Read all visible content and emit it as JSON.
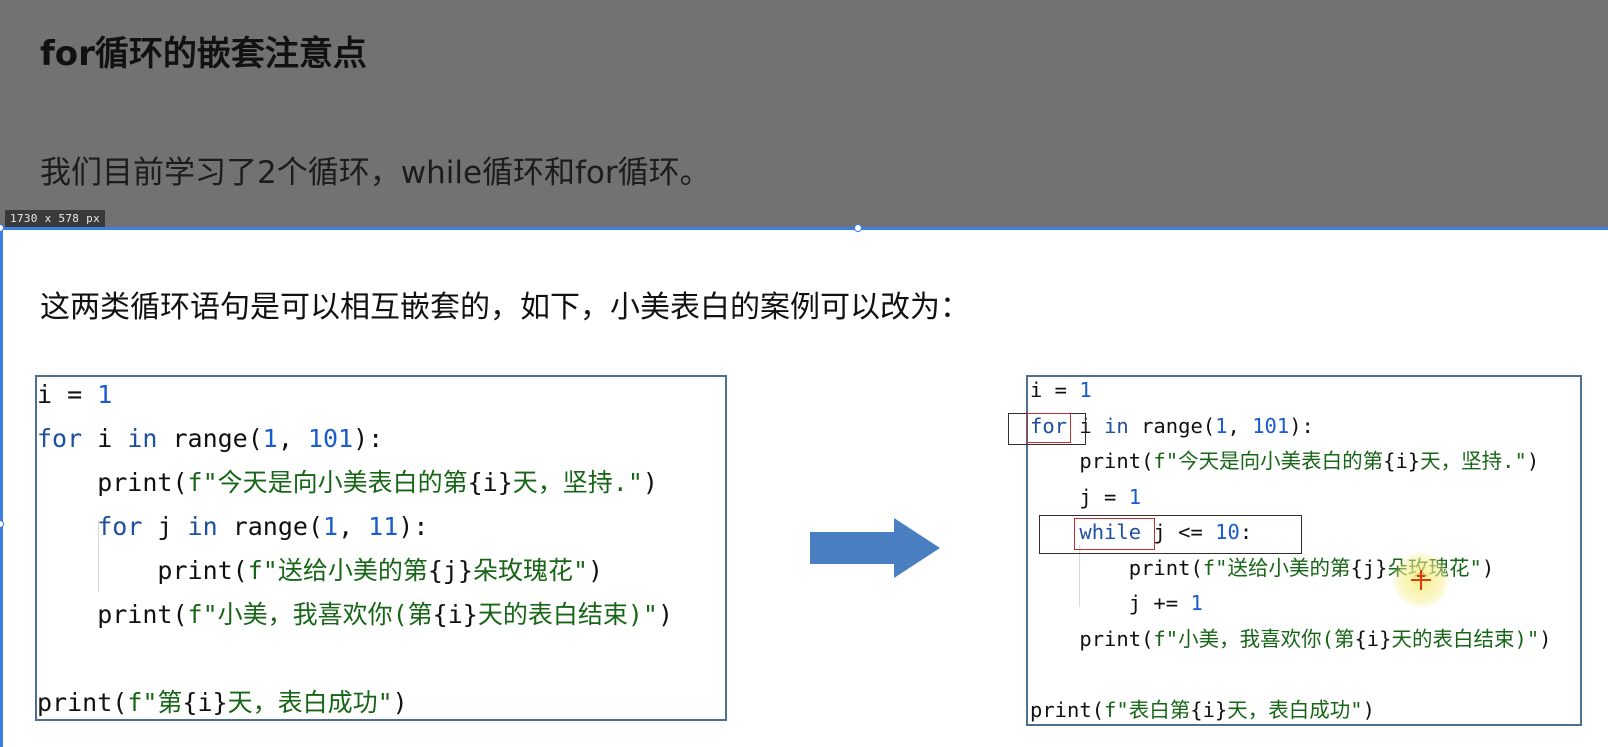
{
  "slide": {
    "title": "for循环的嵌套注意点",
    "subtitle": "我们目前学习了2个循环，while循环和for循环。",
    "intro": "这两类循环语句是可以相互嵌套的，如下，小美表白的案例可以改为："
  },
  "overlay": {
    "size_label": "1730 x 578  px"
  },
  "code_left": {
    "lines": [
      [
        {
          "t": "i = ",
          "c": "fn"
        },
        {
          "t": "1",
          "c": "num"
        }
      ],
      [
        {
          "t": "for",
          "c": "kw"
        },
        {
          "t": " i ",
          "c": "fn"
        },
        {
          "t": "in",
          "c": "kw"
        },
        {
          "t": " range(",
          "c": "fn"
        },
        {
          "t": "1",
          "c": "num"
        },
        {
          "t": ", ",
          "c": "fn"
        },
        {
          "t": "101",
          "c": "num"
        },
        {
          "t": "):",
          "c": "fn"
        }
      ],
      [
        {
          "t": "    print(",
          "c": "fn"
        },
        {
          "t": "f\"今天是向小美表白的第",
          "c": "str"
        },
        {
          "t": "{i}",
          "c": "brace"
        },
        {
          "t": "天，坚持.\"",
          "c": "str"
        },
        {
          "t": ")",
          "c": "fn"
        }
      ],
      [
        {
          "t": "    ",
          "c": "fn"
        },
        {
          "t": "for",
          "c": "kw"
        },
        {
          "t": " j ",
          "c": "fn"
        },
        {
          "t": "in",
          "c": "kw"
        },
        {
          "t": " range(",
          "c": "fn"
        },
        {
          "t": "1",
          "c": "num"
        },
        {
          "t": ", ",
          "c": "fn"
        },
        {
          "t": "11",
          "c": "num"
        },
        {
          "t": "):",
          "c": "fn"
        }
      ],
      [
        {
          "t": "        print(",
          "c": "fn"
        },
        {
          "t": "f\"送给小美的第",
          "c": "str"
        },
        {
          "t": "{j}",
          "c": "brace"
        },
        {
          "t": "朵玫瑰花\"",
          "c": "str"
        },
        {
          "t": ")",
          "c": "fn"
        }
      ],
      [
        {
          "t": "    print(",
          "c": "fn"
        },
        {
          "t": "f\"小美，我喜欢你(第",
          "c": "str"
        },
        {
          "t": "{i}",
          "c": "brace"
        },
        {
          "t": "天的表白结束)\"",
          "c": "str"
        },
        {
          "t": ")",
          "c": "fn"
        }
      ],
      [],
      [
        {
          "t": "print(",
          "c": "fn"
        },
        {
          "t": "f\"第",
          "c": "str"
        },
        {
          "t": "{i}",
          "c": "brace"
        },
        {
          "t": "天，表白成功\"",
          "c": "str"
        },
        {
          "t": ")",
          "c": "fn"
        }
      ]
    ]
  },
  "code_right": {
    "lines": [
      [
        {
          "t": "i = ",
          "c": "fn"
        },
        {
          "t": "1",
          "c": "num"
        }
      ],
      [
        {
          "t": "for",
          "c": "kw"
        },
        {
          "t": " i ",
          "c": "fn"
        },
        {
          "t": "in",
          "c": "kw"
        },
        {
          "t": " range(",
          "c": "fn"
        },
        {
          "t": "1",
          "c": "num"
        },
        {
          "t": ", ",
          "c": "fn"
        },
        {
          "t": "101",
          "c": "num"
        },
        {
          "t": "):",
          "c": "fn"
        }
      ],
      [
        {
          "t": "    print(",
          "c": "fn"
        },
        {
          "t": "f\"今天是向小美表白的第",
          "c": "str"
        },
        {
          "t": "{i}",
          "c": "brace"
        },
        {
          "t": "天，坚持.\"",
          "c": "str"
        },
        {
          "t": ")",
          "c": "fn"
        }
      ],
      [
        {
          "t": "    j = ",
          "c": "fn"
        },
        {
          "t": "1",
          "c": "num"
        }
      ],
      [
        {
          "t": "    ",
          "c": "fn"
        },
        {
          "t": "while",
          "c": "kw"
        },
        {
          "t": " j <= ",
          "c": "fn"
        },
        {
          "t": "10",
          "c": "num"
        },
        {
          "t": ":",
          "c": "fn"
        }
      ],
      [
        {
          "t": "        print(",
          "c": "fn"
        },
        {
          "t": "f\"送给小美的第",
          "c": "str"
        },
        {
          "t": "{j}",
          "c": "brace"
        },
        {
          "t": "朵玫瑰花\"",
          "c": "str"
        },
        {
          "t": ")",
          "c": "fn"
        }
      ],
      [
        {
          "t": "        j += ",
          "c": "fn"
        },
        {
          "t": "1",
          "c": "num"
        }
      ],
      [
        {
          "t": "    print(",
          "c": "fn"
        },
        {
          "t": "f\"小美，我喜欢你(第",
          "c": "str"
        },
        {
          "t": "{i}",
          "c": "brace"
        },
        {
          "t": "天的表白结束)\"",
          "c": "str"
        },
        {
          "t": ")",
          "c": "fn"
        }
      ],
      [],
      [
        {
          "t": "print(",
          "c": "fn"
        },
        {
          "t": "f\"表白第",
          "c": "str"
        },
        {
          "t": "{i}",
          "c": "brace"
        },
        {
          "t": "天，表白成功\"",
          "c": "str"
        },
        {
          "t": ")",
          "c": "fn"
        }
      ]
    ]
  },
  "icons": {
    "arrow": "right-arrow-icon",
    "cursor": "crosshair-cursor-icon"
  },
  "colors": {
    "keyword": "#1e4fa0",
    "number": "#1a5bd0",
    "string": "#176617",
    "arrow": "#4a7fc1",
    "highlight_box": "#c03030",
    "selection": "#3b7fe0"
  }
}
